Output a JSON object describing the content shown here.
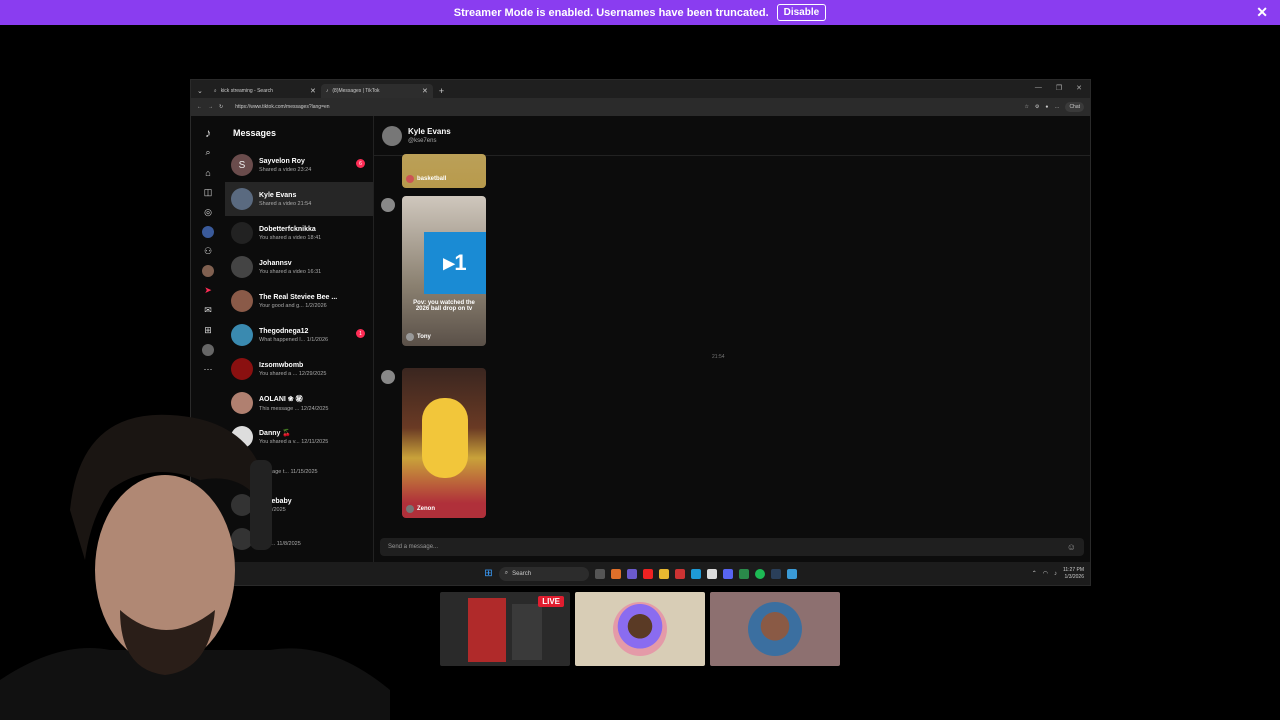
{
  "banner": {
    "text": "Streamer Mode is enabled. Usernames have been truncated.",
    "disable_label": "Disable"
  },
  "browser": {
    "tabs": [
      {
        "label": "kick streaming - Search"
      },
      {
        "label": "(8)Messages | TikTok"
      }
    ],
    "url": "https://www.tiktok.com/messages?lang=en",
    "chat_label": "Chat"
  },
  "tiktok": {
    "messages_title": "Messages",
    "conversations": [
      {
        "initial": "S",
        "name": "Sayvelon Roy",
        "preview": "Shared a video 23:24",
        "badge": "6",
        "color": "#6a4c4c"
      },
      {
        "initial": "",
        "name": "Kyle Evans",
        "preview": "Shared a video 21:54",
        "badge": "",
        "color": "#5a6a80"
      },
      {
        "initial": "",
        "name": "Dobetterfcknikka",
        "preview": "You shared a video 18:41",
        "badge": "",
        "color": "#222"
      },
      {
        "initial": "",
        "name": "Johannsv",
        "preview": "You shared a video 16:31",
        "badge": "",
        "color": "#444"
      },
      {
        "initial": "",
        "name": "The Real Steviee Bee ...",
        "preview": "Your good and g... 1/2/2026",
        "badge": "",
        "color": "#8a5a48"
      },
      {
        "initial": "",
        "name": "Thegodnega12",
        "preview": "What happened l... 1/1/2026",
        "badge": "1",
        "color": "#3a8ab0"
      },
      {
        "initial": "",
        "name": "Izsomwbomb",
        "preview": "You shared a ... 12/29/2025",
        "badge": "",
        "color": "#8a1010"
      },
      {
        "initial": "",
        "name": "AOLANI ❀ ㊙",
        "preview": "This message ... 12/24/2025",
        "badge": "",
        "color": "#b08070"
      },
      {
        "initial": "",
        "name": "Danny 🍒",
        "preview": "You shared a v... 12/11/2025",
        "badge": "",
        "color": "#ddd"
      },
      {
        "initial": "",
        "name": "",
        "preview": "message t... 11/15/2025",
        "badge": "",
        "color": "#333"
      },
      {
        "initial": "",
        "name": "tsmebaby",
        "preview": "11/11/2025",
        "badge": "",
        "color": "#333"
      },
      {
        "initial": "",
        "name": "le",
        "preview": "now ... 11/8/2025",
        "badge": "",
        "color": "#333"
      }
    ],
    "chat": {
      "name": "Kyle Evans",
      "handle": "@kse7ens",
      "videos": [
        {
          "caption": "basketball"
        },
        {
          "overlay": "Pov: you watched the 2026 ball drop on tv",
          "caption": "Tony"
        },
        {
          "caption": "Zenon"
        }
      ],
      "timestamp": "21:54",
      "composer_placeholder": "Send a message..."
    }
  },
  "taskbar": {
    "search_label": "Search",
    "time": "11:27 PM",
    "date": "1/3/2026"
  },
  "stream": {
    "live_label": "LIVE"
  }
}
